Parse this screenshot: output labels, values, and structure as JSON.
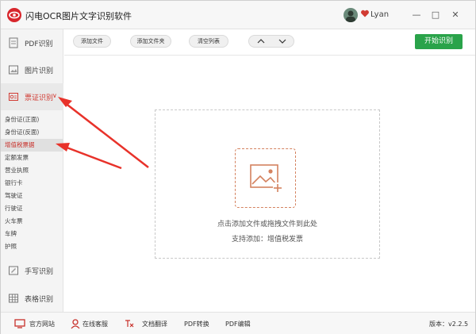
{
  "titlebar": {
    "app_title": "闪电OCR图片文字识别软件",
    "user_name": "Lyan",
    "minimize": "—",
    "maximize": "□",
    "close": "✕"
  },
  "sidebar": {
    "items": [
      {
        "label": "PDF识别",
        "icon": "pdf-icon"
      },
      {
        "label": "图片识别",
        "icon": "image-icon"
      },
      {
        "label": "票证识别",
        "icon": "ticket-icon",
        "expanded_marker": "∨"
      },
      {
        "label": "手写识别",
        "icon": "handwriting-icon"
      },
      {
        "label": "表格识别",
        "icon": "table-icon"
      }
    ],
    "submenu": [
      "身份证(正面)",
      "身份证(反面)",
      "增值税票据",
      "定额发票",
      "营业执照",
      "银行卡",
      "驾驶证",
      "行驶证",
      "火车票",
      "车牌",
      "护照"
    ],
    "selected_submenu": "增值税票据"
  },
  "toolbar": {
    "add_file": "添加文件",
    "add_folder": "添加文件夹",
    "clear_list": "清空列表",
    "start": "开始识别"
  },
  "dropzone": {
    "hint": "点击添加文件或拖拽文件到此处",
    "support": "支持添加：增值税发票"
  },
  "bottombar": {
    "website": "官方网站",
    "service": "在线客服",
    "translate": "文档翻译",
    "pdf_convert": "PDF转换",
    "pdf_edit": "PDF编辑",
    "version": "版本：v2.2.5"
  },
  "colors": {
    "accent_red": "#d13b33",
    "start_green": "#2aa34a",
    "drop_icon": "#d4825f"
  }
}
